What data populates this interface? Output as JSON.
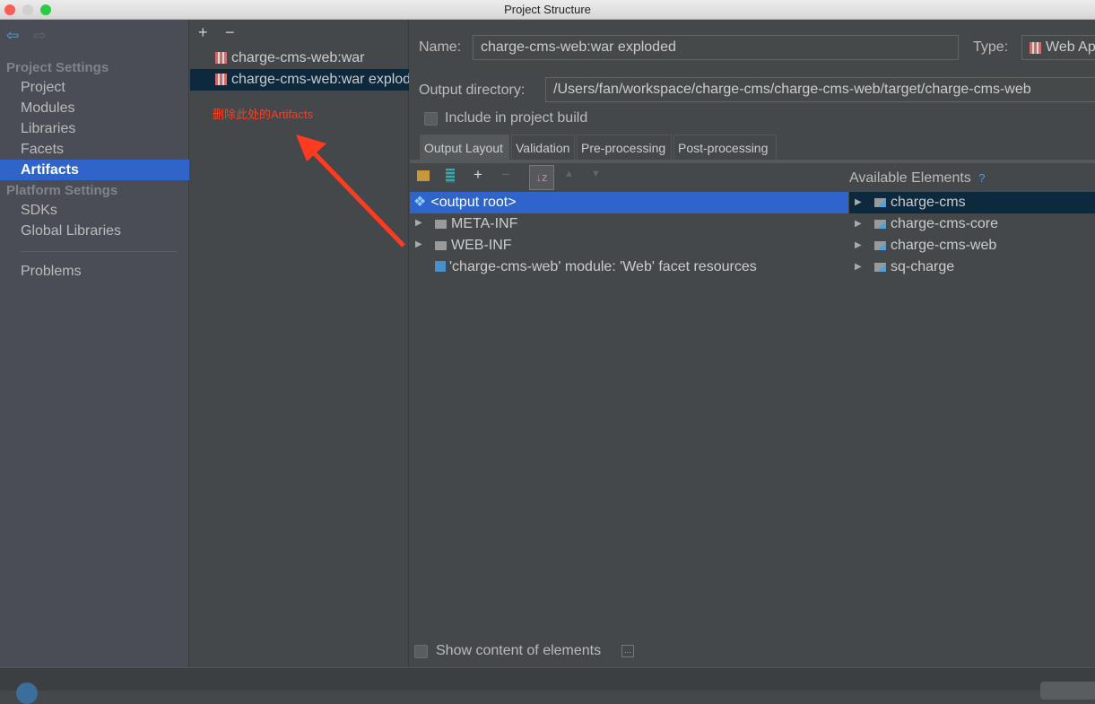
{
  "window": {
    "title": "Project Structure"
  },
  "sidebar": {
    "sections": [
      {
        "label": "Project Settings",
        "items": [
          "Project",
          "Modules",
          "Libraries",
          "Facets",
          "Artifacts"
        ]
      },
      {
        "label": "Platform Settings",
        "items": [
          "SDKs",
          "Global Libraries"
        ]
      }
    ],
    "problems": "Problems",
    "selected": "Artifacts"
  },
  "artifacts": {
    "add": "+",
    "remove": "−",
    "items": [
      "charge-cms-web:war",
      "charge-cms-web:war exploded"
    ],
    "annotation": "删除此处的Artifacts"
  },
  "main": {
    "name_label": "Name:",
    "name_value": "charge-cms-web:war exploded",
    "type_label": "Type:",
    "type_value": "Web Application: Exploded",
    "output_label": "Output directory:",
    "output_value": "/Users/fan/workspace/charge-cms/charge-cms-web/target/charge-cms-web",
    "include_label": "Include in project build",
    "include_checked": false,
    "tabs": [
      "Output Layout",
      "Validation",
      "Pre-processing",
      "Post-processing"
    ],
    "selected_tab": "Output Layout",
    "tree": [
      {
        "label": "<output root>",
        "icon": "output-root-icon"
      },
      {
        "label": "META-INF",
        "icon": "folder-icon"
      },
      {
        "label": "WEB-INF",
        "icon": "folder-icon"
      },
      {
        "label": "'charge-cms-web' module: 'Web' facet resources",
        "icon": "web-facet-icon"
      }
    ],
    "available_label": "Available Elements",
    "help": "?",
    "available": [
      "charge-cms",
      "charge-cms-core",
      "charge-cms-web",
      "sq-charge"
    ],
    "show_content_label": "Show content of elements",
    "show_content_checked": false,
    "ellipsis": "..."
  },
  "colors": {
    "accent": "#2f65ca",
    "annotation": "#ff3b1f"
  }
}
